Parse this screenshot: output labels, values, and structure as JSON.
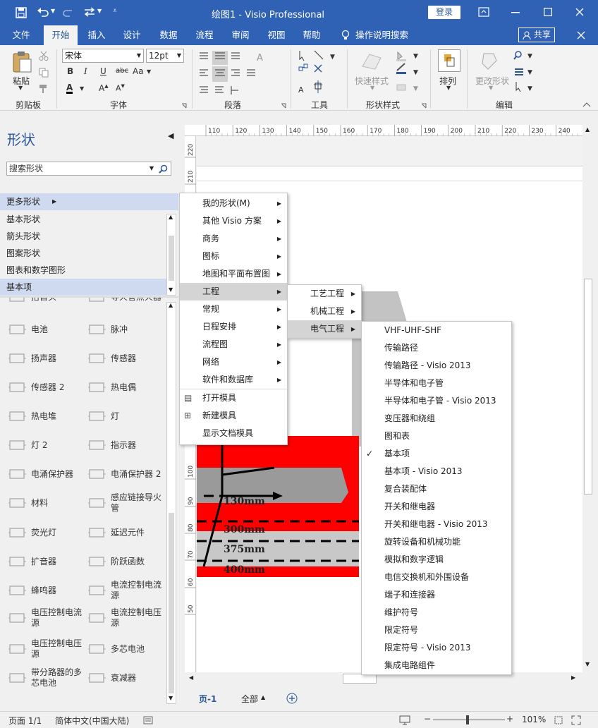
{
  "titlebar": {
    "title": "绘图1  -  Visio Professional",
    "login": "登录"
  },
  "tabs": [
    "文件",
    "开始",
    "插入",
    "设计",
    "数据",
    "流程",
    "审阅",
    "视图",
    "帮助"
  ],
  "tell_me": "操作说明搜索",
  "share": "共享",
  "ribbon": {
    "groups": {
      "clipboard": "剪贴板",
      "font": "字体",
      "paragraph": "段落",
      "tools": "工具",
      "shape_styles": "形状样式",
      "arrange_label": "排列",
      "edit": "编辑"
    },
    "paste": "粘贴",
    "font_name": "宋体",
    "font_size": "12pt",
    "quick_styles": "快速样式",
    "change_shape": "更改形状"
  },
  "shapes_pane": {
    "title": "形状",
    "search_placeholder": "搜索形状",
    "more_shapes": "更多形状",
    "stencils": [
      "基本形状",
      "箭头形状",
      "图案形状",
      "图表和数学图形",
      "基本项"
    ],
    "items": [
      [
        "抬首头",
        "导火管点火器"
      ],
      [
        "电池",
        "脉冲"
      ],
      [
        "扬声器",
        "传感器"
      ],
      [
        "传感器 2",
        "热电偶"
      ],
      [
        "热电堆",
        "灯"
      ],
      [
        "灯 2",
        "指示器"
      ],
      [
        "电涌保护器",
        "电涌保护器 2"
      ],
      [
        "材料",
        "感应链接导火管"
      ],
      [
        "荧光灯",
        "延迟元件"
      ],
      [
        "扩音器",
        "阶跃函数"
      ],
      [
        "蜂鸣器",
        "电流控制电流源"
      ],
      [
        "电压控制电流源",
        "电流控制电压源"
      ],
      [
        "电压控制电压源",
        "多芯电池"
      ],
      [
        "带分路器的多芯电池",
        "衰减器"
      ]
    ]
  },
  "ruler": {
    "h": [
      "110",
      "120",
      "130",
      "140",
      "150",
      "160",
      "170",
      "180",
      "190",
      "200",
      "210",
      "220",
      "230",
      "240"
    ],
    "v": [
      "220",
      "210",
      "100",
      "90",
      "80",
      "70",
      "60",
      "50"
    ]
  },
  "drawing": {
    "labels": [
      "130mm",
      "300mm",
      "375mm",
      "400mm"
    ]
  },
  "menu1": [
    "我的形状(M)",
    "其他 Visio 方案",
    "商务",
    "图标",
    "地图和平面布置图",
    "工程",
    "常规",
    "日程安排",
    "流程图",
    "网络",
    "软件和数据库",
    "打开模具",
    "新建模具",
    "显示文档模具"
  ],
  "menu2": [
    "工艺工程",
    "机械工程",
    "电气工程"
  ],
  "menu3": [
    "VHF-UHF-SHF",
    "传输路径",
    "传输路径 - Visio 2013",
    "半导体和电子管",
    "半导体和电子管 - Visio 2013",
    "变压器和绕组",
    "图和表",
    "基本项",
    "基本项 - Visio 2013",
    "复合装配体",
    "开关和继电器",
    "开关和继电器 - Visio 2013",
    "旋转设备和机械功能",
    "模拟和数字逻辑",
    "电信交换机和外围设备",
    "端子和连接器",
    "维护符号",
    "限定符号",
    "限定符号 - Visio 2013",
    "集成电路组件"
  ],
  "pages": {
    "page": "页-1",
    "all": "全部"
  },
  "status": {
    "page": "页面 1/1",
    "lang": "简体中文(中国大陆)",
    "zoom": "101%"
  },
  "colors": {
    "accent": "#2b579a",
    "title_bar": "#2f62b5",
    "drawing_red": "#ff0000"
  }
}
